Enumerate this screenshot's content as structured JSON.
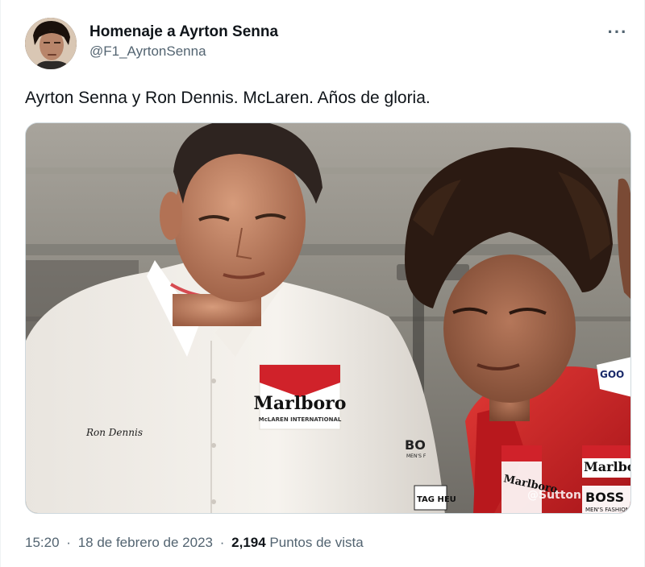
{
  "author": {
    "display_name": "Homenaje a Ayrton Senna",
    "handle": "@F1_AyrtonSenna"
  },
  "more_icon": "more-horizontal-icon",
  "tweet": {
    "text": "Ayrton Senna y Ron Dennis. McLaren. Años de gloria."
  },
  "photo": {
    "shirt_name": "Ron Dennis",
    "logo_text": "Marlboro",
    "logo_subtext": "McLAREN INTERNATIONAL",
    "suit_logo": "Marlboro",
    "sponsor_goodyear": "GOO",
    "sponsor_boss": "BOSS",
    "sponsor_boss_sub": "MEN'S FASHION",
    "sleeve_text": "BO",
    "sleeve_sub": "MEN'S F",
    "tag_text": "TAG HEU",
    "watermark": "@Sutton",
    "colors": {
      "background": "#8f8e88",
      "shirt": "#ece8e2",
      "suit_red": "#d0222a",
      "skin": "#b47a5a",
      "hair": "#2b1a12"
    }
  },
  "meta": {
    "time": "15:20",
    "dot": "·",
    "date": "18 de febrero de 2023",
    "views_count": "2,194",
    "views_label": "Puntos de vista"
  }
}
